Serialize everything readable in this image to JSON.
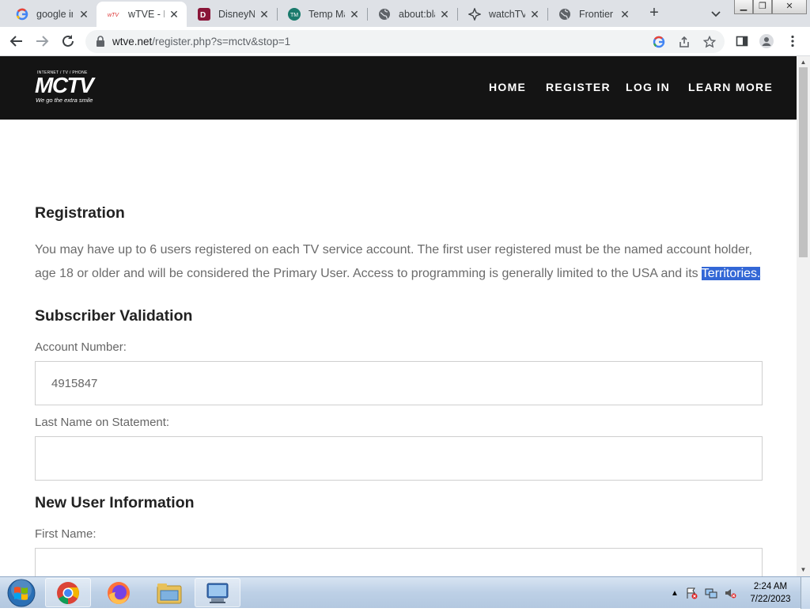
{
  "browser": {
    "tabs": [
      {
        "title": "google in",
        "icon": "google-icon"
      },
      {
        "title": "wTVE - R",
        "icon": "wtve-icon"
      },
      {
        "title": "DisneyNC",
        "icon": "disney-icon"
      },
      {
        "title": "Temp Ma",
        "icon": "temp-mail-icon"
      },
      {
        "title": "about:bla",
        "icon": "globe-icon"
      },
      {
        "title": "watchTVe",
        "icon": "watchtve-icon"
      },
      {
        "title": "Frontier",
        "icon": "globe-icon"
      }
    ],
    "active_tab": 1,
    "url_host": "wtve.net",
    "url_path": "/register.php?s=mctv&stop=1"
  },
  "site": {
    "logo_small": "INTERNET / TV / PHONE",
    "logo_main": "MCTV",
    "logo_tagline": "We go the extra smile",
    "nav": [
      "HOME",
      "REGISTER",
      "LOG IN",
      "LEARN MORE"
    ]
  },
  "registration": {
    "heading": "Registration",
    "para_line1": "You may have up to 6 users registered on each TV service account. The first user registered must be the named account holder,",
    "para_line2_pre": "age 18 or older and will be considered the Primary User. Access to programming is generally limited to the USA and its ",
    "para_selected": "Territories."
  },
  "subscriber_validation": {
    "heading": "Subscriber Validation",
    "account_label": "Account Number:",
    "account_value": "4915847",
    "lastname_label": "Last Name on Statement:",
    "lastname_value": ""
  },
  "new_user": {
    "heading": "New User Information",
    "firstname_label": "First Name:",
    "firstname_value": ""
  },
  "taskbar": {
    "time": "2:24 AM",
    "date": "7/22/2023",
    "apps": [
      "chrome-icon",
      "firefox-icon",
      "file-explorer-icon",
      "remote-desktop-icon"
    ]
  }
}
